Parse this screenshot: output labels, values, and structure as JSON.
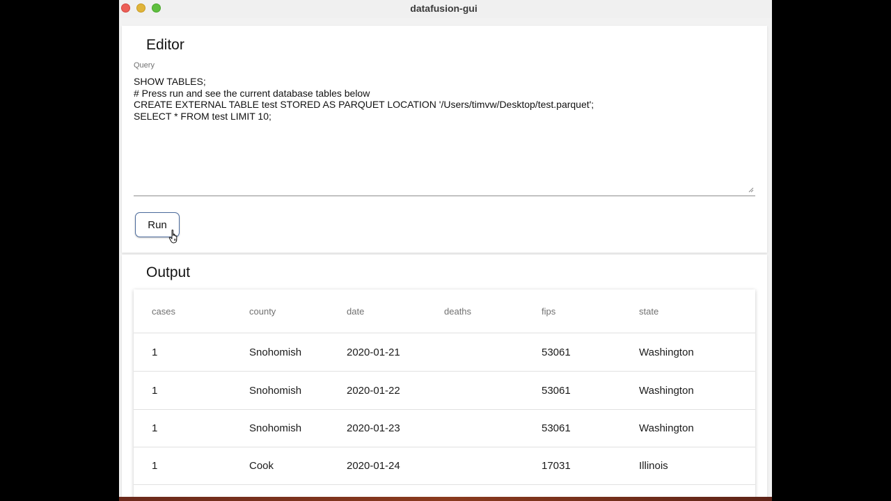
{
  "window": {
    "title": "datafusion-gui"
  },
  "editor": {
    "heading": "Editor",
    "query_label": "Query",
    "query_lines": [
      "SHOW TABLES;",
      "# Press run and see the current database tables below",
      "CREATE EXTERNAL TABLE test STORED AS PARQUET LOCATION '/Users/timvw/Desktop/test.parquet';",
      "SELECT * FROM test LIMIT 10;"
    ],
    "run_label": "Run"
  },
  "output": {
    "heading": "Output",
    "columns": [
      "cases",
      "county",
      "date",
      "deaths",
      "fips",
      "state"
    ],
    "rows": [
      [
        "1",
        "Snohomish",
        "2020-01-21",
        "",
        "53061",
        "Washington"
      ],
      [
        "1",
        "Snohomish",
        "2020-01-22",
        "",
        "53061",
        "Washington"
      ],
      [
        "1",
        "Snohomish",
        "2020-01-23",
        "",
        "53061",
        "Washington"
      ],
      [
        "1",
        "Cook",
        "2020-01-24",
        "",
        "17031",
        "Illinois"
      ]
    ]
  },
  "colors": {
    "close": "#ec5f57",
    "minimize": "#e0b43a",
    "zoom": "#5fbf3f",
    "run_border": "#4a6a9c"
  },
  "icons": {
    "cursor": "hand-pointer-icon",
    "resize": "resize-handle-icon"
  }
}
